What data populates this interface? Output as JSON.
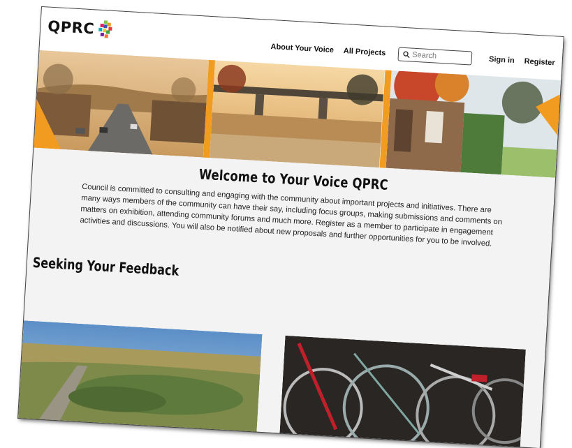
{
  "header": {
    "logo_text": "QPRC",
    "nav": {
      "about": "About Your Voice",
      "projects": "All Projects",
      "sign_in": "Sign in",
      "register": "Register"
    },
    "search": {
      "placeholder": "Search"
    }
  },
  "hero": {
    "panels": [
      "town-street",
      "bridge-over-river",
      "historic-verandah"
    ],
    "accent_color": "#f29b21"
  },
  "welcome": {
    "title": "Welcome to Your Voice QPRC",
    "body": "Council is committed to consulting and engaging with the community about important projects and initiatives. There are many ways members of the community can have their say, including focus groups, making submissions and comments on matters on exhibition, attending community forums and much more. Register as a member to participate in engagement activities and discussions. You will also be notified about new proposals and further opportunities for you to be involved."
  },
  "feedback": {
    "title": "Seeking Your Feedback",
    "cards": [
      "aerial-landscape",
      "bicycles"
    ]
  }
}
